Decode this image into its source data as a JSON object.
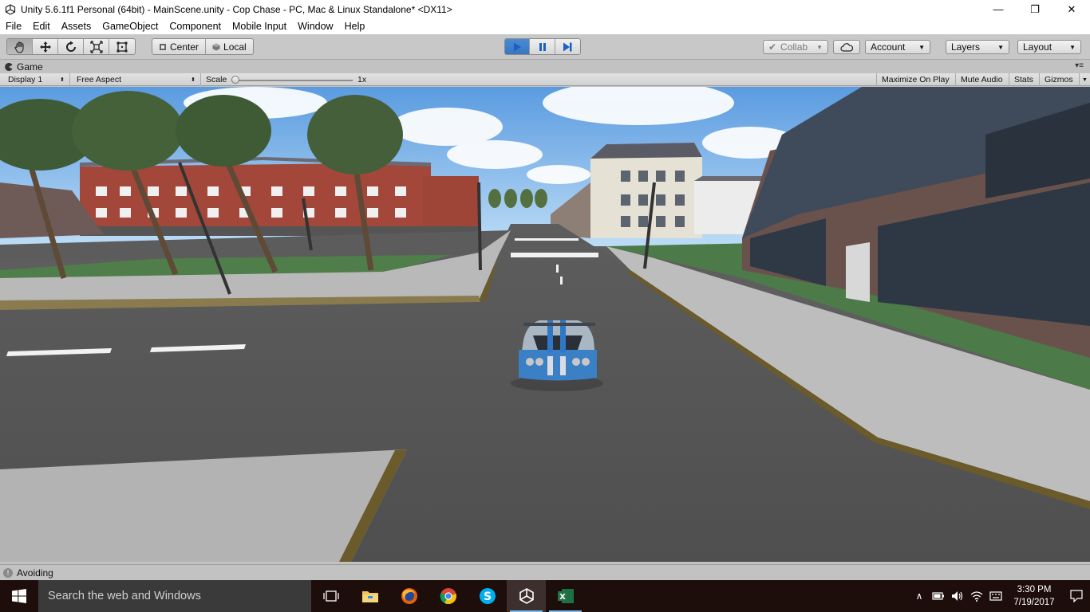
{
  "window": {
    "title": "Unity 5.6.1f1 Personal (64bit) - MainScene.unity - Cop Chase - PC, Mac & Linux Standalone* <DX11>",
    "minimize_glyph": "—",
    "maximize_glyph": "❐",
    "close_glyph": "✕"
  },
  "menu": [
    "File",
    "Edit",
    "Assets",
    "GameObject",
    "Component",
    "Mobile Input",
    "Window",
    "Help"
  ],
  "toolbar": {
    "transform_tools": [
      {
        "name": "hand-tool",
        "icon": "hand-icon",
        "active": true
      },
      {
        "name": "move-tool",
        "icon": "move-icon"
      },
      {
        "name": "rotate-tool",
        "icon": "rotate-icon"
      },
      {
        "name": "scale-tool",
        "icon": "scale-icon"
      },
      {
        "name": "rect-tool",
        "icon": "rect-icon"
      }
    ],
    "pivot_label": "Center",
    "space_label": "Local",
    "play_state": "playing",
    "collab_label": "Collab",
    "account_label": "Account",
    "layers_label": "Layers",
    "layout_label": "Layout"
  },
  "game_panel": {
    "tab_label": "Game",
    "display_label": "Display 1",
    "aspect_label": "Free Aspect",
    "scale_label": "Scale",
    "scale_value": "1x",
    "scale_fraction": 0.0,
    "maximize_on_play": "Maximize On Play",
    "mute_audio": "Mute Audio",
    "stats": "Stats",
    "gizmos": "Gizmos"
  },
  "status": {
    "message": "Avoiding"
  },
  "taskbar": {
    "search_placeholder": "Search the web and Windows",
    "apps": [
      "task-view",
      "file-explorer",
      "firefox",
      "chrome",
      "skype",
      "unity",
      "excel"
    ],
    "time": "3:30 PM",
    "date": "7/19/2017"
  },
  "colors": {
    "play_blue": "#3b76c0",
    "taskbar": "#1d0d0b",
    "editor_gray": "#c2c2c2"
  }
}
